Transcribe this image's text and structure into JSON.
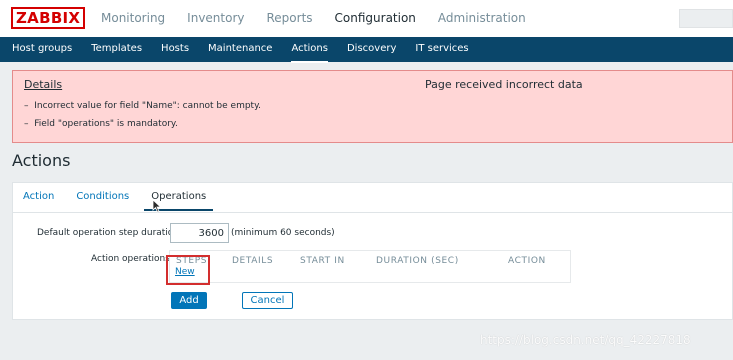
{
  "logo": "ZABBIX",
  "main_menu": [
    {
      "label": "Monitoring"
    },
    {
      "label": "Inventory"
    },
    {
      "label": "Reports"
    },
    {
      "label": "Configuration"
    },
    {
      "label": "Administration"
    }
  ],
  "sub_menu": [
    {
      "label": "Host groups"
    },
    {
      "label": "Templates"
    },
    {
      "label": "Hosts"
    },
    {
      "label": "Maintenance"
    },
    {
      "label": "Actions"
    },
    {
      "label": "Discovery"
    },
    {
      "label": "IT services"
    }
  ],
  "error": {
    "details_label": "Details",
    "title": "Page received incorrect data",
    "items": [
      "Incorrect value for field \"Name\": cannot be empty.",
      "Field \"operations\" is mandatory."
    ]
  },
  "page_title": "Actions",
  "tabs": [
    {
      "label": "Action"
    },
    {
      "label": "Conditions"
    },
    {
      "label": "Operations"
    }
  ],
  "form": {
    "duration_label": "Default operation step duration",
    "duration_value": "3600",
    "duration_note": "(minimum 60 seconds)",
    "ops_label": "Action operations",
    "ops_headers": [
      "STEPS",
      "DETAILS",
      "START IN",
      "DURATION (SEC)",
      "ACTION"
    ],
    "new_link": "New",
    "add_button": "Add",
    "cancel_button": "Cancel"
  },
  "watermark": "https://blog.csdn.net/qq_42227818",
  "colors": {
    "brand": "#d40000",
    "nav_bg": "#0a466a",
    "link": "#0275b8",
    "error_bg": "#ffd6d6",
    "highlight_box": "#d32e2e"
  }
}
